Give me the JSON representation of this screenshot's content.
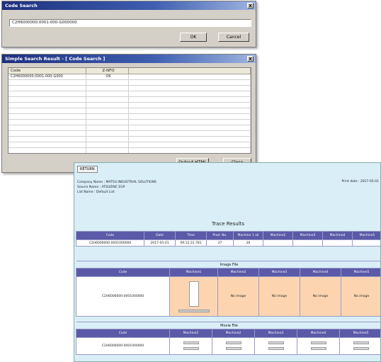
{
  "code_search": {
    "title": "Code Search",
    "close_glyph": "x",
    "input_value": "C2H6000000:0001-000-G000000",
    "ok_label": "OK",
    "cancel_label": "Cancel"
  },
  "results_dialog": {
    "title": "Simple Search Result - [ Code Search ]",
    "close_glyph": "x",
    "columns": [
      "Code",
      "Z-NFO"
    ],
    "rows": [
      {
        "code": "C2H6000000:0001-000-G000",
        "status": "OK"
      }
    ],
    "output_label": "Output HTML",
    "close_label": "Close"
  },
  "web": {
    "return_label": "RETURN",
    "company_line": "Company Name : MATSU INDUSTRIAL SOLUTIONS",
    "source_line": "Source Name : ATSUZINC EGP",
    "list_line": "List Name : Default List",
    "date_line": "Print date : 2017-05-01",
    "title": "Trace Results",
    "main_table": {
      "headers": [
        "Code",
        "Date",
        "Time",
        "Prod. No.",
        "Machine 1 ok",
        "Machine2",
        "Machine3",
        "Machine4",
        "Machine5"
      ],
      "row": [
        "C2H6000000:0001000000",
        "2017-05-01",
        "09:12:31.781",
        "37",
        "26",
        "",
        "",
        "",
        ""
      ]
    },
    "image_section": {
      "caption": "Image File",
      "headers": [
        "Code",
        "Machine1",
        "Machine2",
        "Machine3",
        "Machine4",
        "Machine5"
      ],
      "code": "C2H6000000:0001000000",
      "no_image": "No image"
    },
    "movie_section": {
      "caption": "Movie File",
      "headers": [
        "Code",
        "Machine1",
        "Machine2",
        "Machine3",
        "Machine4",
        "Machine5"
      ],
      "code": "C2H6000000:0001000000"
    }
  }
}
